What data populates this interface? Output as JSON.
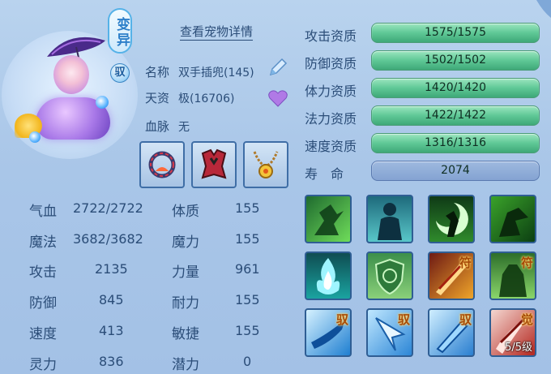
{
  "header": {
    "variant_label": "变异",
    "yu_badge": "驭",
    "detail_link": "查看宠物详情"
  },
  "info": {
    "name_label": "名称",
    "name_value": "双手插兜(145)",
    "talent_label": "天资",
    "talent_value": "极(16706)",
    "bloodline_label": "血脉",
    "bloodline_value": "无"
  },
  "equipment": [
    {
      "icon": "red-gem-bracelet-icon"
    },
    {
      "icon": "red-armor-icon"
    },
    {
      "icon": "gold-amulet-icon"
    }
  ],
  "attributes": {
    "left": [
      {
        "label": "气血",
        "value": "2722/2722"
      },
      {
        "label": "魔法",
        "value": "3682/3682"
      },
      {
        "label": "攻击",
        "value": "2135"
      },
      {
        "label": "防御",
        "value": "845"
      },
      {
        "label": "速度",
        "value": "413"
      },
      {
        "label": "灵力",
        "value": "836"
      }
    ],
    "right": [
      {
        "label": "体质",
        "value": "155"
      },
      {
        "label": "魔力",
        "value": "155"
      },
      {
        "label": "力量",
        "value": "961"
      },
      {
        "label": "耐力",
        "value": "155"
      },
      {
        "label": "敏捷",
        "value": "155"
      },
      {
        "label": "潜力",
        "value": "0"
      }
    ]
  },
  "aptitudes": [
    {
      "label": "攻击资质",
      "value": "1575/1575"
    },
    {
      "label": "防御资质",
      "value": "1502/1502"
    },
    {
      "label": "体力资质",
      "value": "1420/1420"
    },
    {
      "label": "法力资质",
      "value": "1422/1422"
    },
    {
      "label": "速度资质",
      "value": "1316/1316"
    }
  ],
  "lifespan": {
    "label": "寿　命",
    "value": "2074"
  },
  "skills": [
    {
      "icon": "running-warrior-icon",
      "tag": ""
    },
    {
      "icon": "shadow-figure-icon",
      "tag": ""
    },
    {
      "icon": "moon-assassin-icon",
      "tag": ""
    },
    {
      "icon": "green-claw-icon",
      "tag": ""
    },
    {
      "icon": "blue-flame-icon",
      "tag": ""
    },
    {
      "icon": "green-shield-icon",
      "tag": ""
    },
    {
      "icon": "red-blade-icon",
      "tag": "符"
    },
    {
      "icon": "green-giant-icon",
      "tag": "符"
    },
    {
      "icon": "blue-slash-icon",
      "tag": "驭"
    },
    {
      "icon": "ice-shard-icon",
      "tag": "驭"
    },
    {
      "icon": "ice-sword-icon",
      "tag": "驭"
    },
    {
      "icon": "awaken-strike-icon",
      "tag": "觉",
      "level": "5/5级"
    }
  ],
  "colors": {
    "background": "#b3cdec",
    "text": "#2b4d78",
    "aptitude_bar": "#5fc896",
    "lifespan_bar": "#8aa8d5"
  }
}
